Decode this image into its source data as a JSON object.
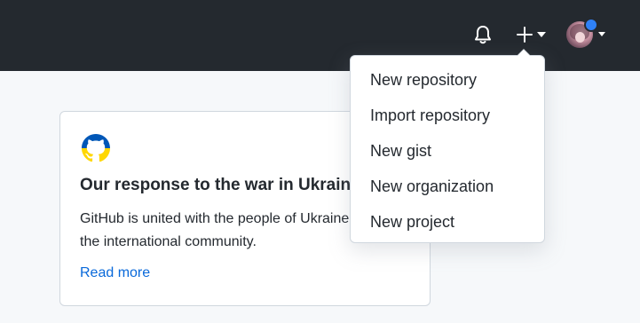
{
  "header": {
    "notifications_icon": "bell-icon",
    "create_icon": "plus-icon",
    "avatar_status_color": "#2f81f7",
    "background": "#24292f"
  },
  "card": {
    "title": "Our response to the war in Ukraine",
    "body_line1": "GitHub is united with the people of Ukraine and",
    "body_line2": "the international community.",
    "link_label": "Read more",
    "logo_colors": [
      "#0057b7",
      "#ffd700"
    ]
  },
  "create_menu": {
    "items": [
      {
        "label": "New repository"
      },
      {
        "label": "Import repository"
      },
      {
        "label": "New gist"
      },
      {
        "label": "New organization"
      },
      {
        "label": "New project"
      }
    ]
  },
  "colors": {
    "link": "#0969da",
    "page_background": "#f6f8fa"
  }
}
